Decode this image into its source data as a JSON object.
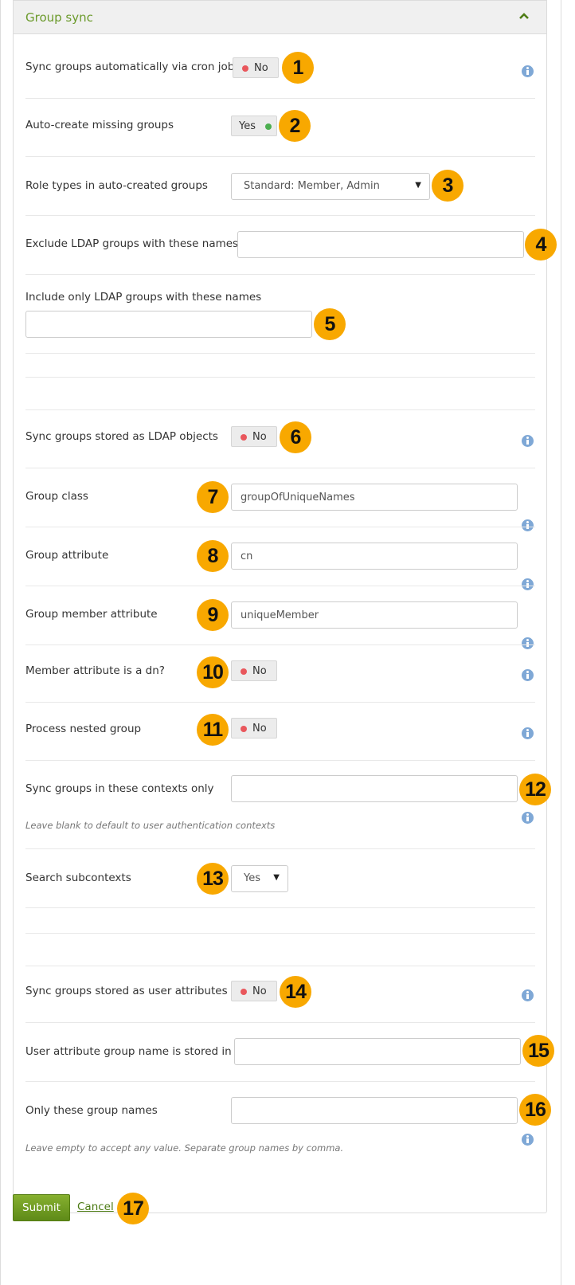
{
  "panel": {
    "title": "Group sync",
    "collapse_icon": "chevron-up-icon"
  },
  "fields": {
    "sync_cron": {
      "label": "Sync groups automatically via cron job",
      "value": "No",
      "badge": "1"
    },
    "auto_create": {
      "label": "Auto-create missing groups",
      "value": "Yes",
      "badge": "2"
    },
    "role_types": {
      "label": "Role types in auto-created groups",
      "selected": "Standard: Member, Admin",
      "badge": "3"
    },
    "exclude_ldap": {
      "label": "Exclude LDAP groups with these names",
      "value": "",
      "badge": "4"
    },
    "include_ldap": {
      "label": "Include only LDAP groups with these names",
      "value": "",
      "badge": "5"
    },
    "sync_ldap_objects": {
      "label": "Sync groups stored as LDAP objects",
      "value": "No",
      "badge": "6"
    },
    "group_class": {
      "label": "Group class",
      "value": "groupOfUniqueNames",
      "badge": "7"
    },
    "group_attribute": {
      "label": "Group attribute",
      "value": "cn",
      "badge": "8"
    },
    "group_member_attribute": {
      "label": "Group member attribute",
      "value": "uniqueMember",
      "badge": "9"
    },
    "member_is_dn": {
      "label": "Member attribute is a dn?",
      "value": "No",
      "badge": "10"
    },
    "nested_group": {
      "label": "Process nested group",
      "value": "No",
      "badge": "11"
    },
    "contexts": {
      "label": "Sync groups in these contexts only",
      "value": "",
      "description": "Leave blank to default to user authentication contexts",
      "badge": "12"
    },
    "subcontexts": {
      "label": "Search subcontexts",
      "selected": "Yes",
      "badge": "13"
    },
    "sync_user_attrs": {
      "label": "Sync groups stored as user attributes",
      "value": "No",
      "badge": "14"
    },
    "user_attr_group": {
      "label": "User attribute group name is stored in",
      "value": "",
      "badge": "15"
    },
    "only_group_names": {
      "label": "Only these group names",
      "value": "",
      "description": "Leave empty to accept any value. Separate group names by comma.",
      "badge": "16"
    }
  },
  "actions": {
    "submit_label": "Submit",
    "cancel_label": "Cancel",
    "badge": "17"
  },
  "colors": {
    "accent": "#6b9a2b",
    "badge": "#f8a800",
    "switch_off": "#e9575c",
    "switch_on": "#4caf50",
    "info": "#7fa8d6"
  }
}
